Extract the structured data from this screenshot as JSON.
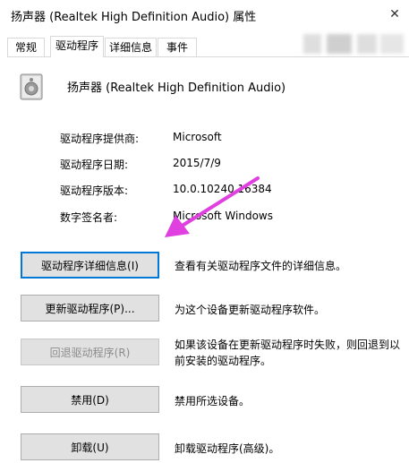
{
  "window": {
    "title": "扬声器 (Realtek High Definition Audio) 属性",
    "close_glyph": "✕"
  },
  "tabs": [
    {
      "label": "常规",
      "active": false
    },
    {
      "label": "驱动程序",
      "active": true
    },
    {
      "label": "详细信息",
      "active": false
    },
    {
      "label": "事件",
      "active": false
    }
  ],
  "device": {
    "name": "扬声器 (Realtek High Definition Audio)",
    "icon": "speaker-icon"
  },
  "driver_info": [
    {
      "label": "驱动程序提供商:",
      "value": "Microsoft"
    },
    {
      "label": "驱动程序日期:",
      "value": "2015/7/9"
    },
    {
      "label": "驱动程序版本:",
      "value": "10.0.10240.16384"
    },
    {
      "label": "数字签名者:",
      "value": "Microsoft Windows"
    }
  ],
  "actions": [
    {
      "button": "驱动程序详细信息(I)",
      "description": "查看有关驱动程序文件的详细信息。",
      "enabled": true,
      "focused": true
    },
    {
      "button": "更新驱动程序(P)...",
      "description": "为这个设备更新驱动程序软件。",
      "enabled": true,
      "focused": false
    },
    {
      "button": "回退驱动程序(R)",
      "description": "如果该设备在更新驱动程序时失败，则回退到以前安装的驱动程序。",
      "enabled": false,
      "focused": false
    },
    {
      "button": "禁用(D)",
      "description": "禁用所选设备。",
      "enabled": true,
      "focused": false
    },
    {
      "button": "卸载(U)",
      "description": "卸载驱动程序(高级)。",
      "enabled": true,
      "focused": false
    }
  ],
  "colors": {
    "arrow": "#e040e0",
    "focus_border": "#0078d7",
    "button_bg": "#e1e1e1"
  }
}
